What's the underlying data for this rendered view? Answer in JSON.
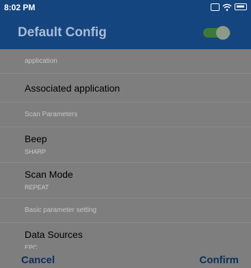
{
  "status_bar": {
    "time": "8:02 PM",
    "icons": [
      "scan-icon",
      "wifi-icon",
      "battery-icon"
    ]
  },
  "header": {
    "title": "Default Config",
    "toggle_on": true
  },
  "sections": {
    "application": "application",
    "scan_params": "Scan Parameters",
    "basic": "Basic parameter setting"
  },
  "rows": {
    "associated_application": "Associated application",
    "beep": {
      "title": "Beep",
      "value": "SHARP"
    },
    "scan_mode": {
      "title": "Scan Mode",
      "value": "REPEAT"
    },
    "data_sources": {
      "title": "Data Sources",
      "value": "EPC"
    }
  },
  "footer": {
    "cancel": "Cancel",
    "confirm": "Confirm"
  },
  "colors": {
    "header_bg": "#15457f",
    "dim_bg": "#7e7e7e",
    "toggle_track": "#3d7a3a"
  }
}
